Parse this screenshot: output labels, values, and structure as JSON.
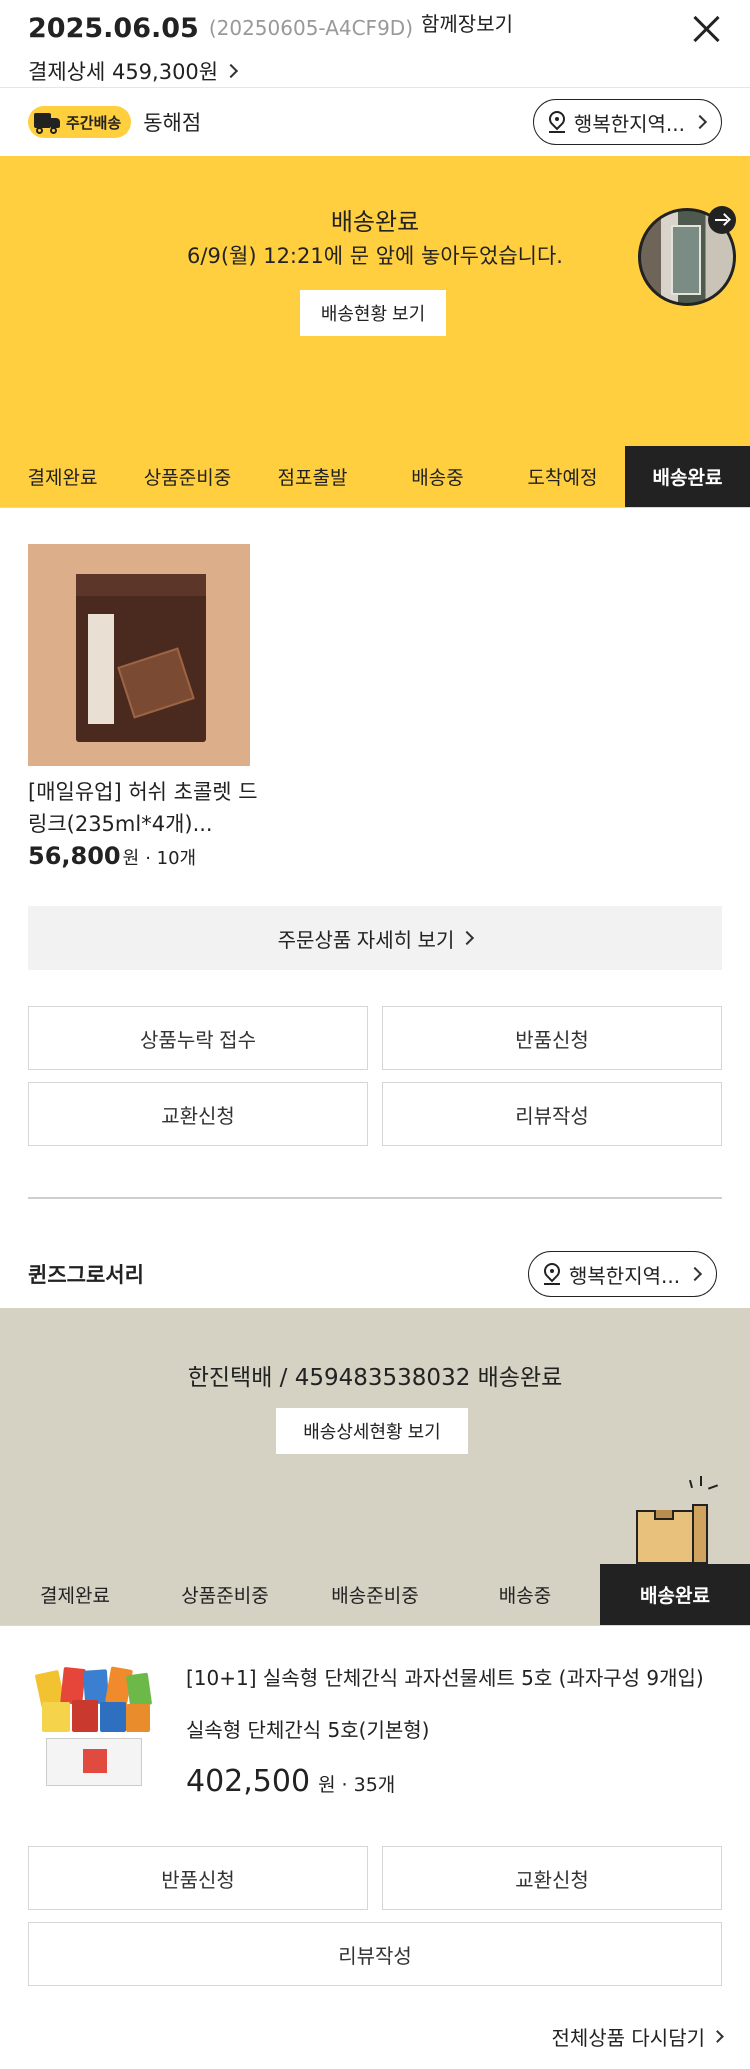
{
  "header": {
    "order_date": "2025.06.05",
    "order_no": "(20250605-A4CF9D)",
    "together_label": "함께장보기",
    "payment_detail": "결제상세 459,300원"
  },
  "shipment1": {
    "badge": "주간배송",
    "store_name": "동해점",
    "location": "행복한지역...",
    "status_title": "배송완료",
    "status_message": "6/9(월) 12:21에 문 앞에 놓아두었습니다.",
    "status_button": "배송현황 보기",
    "steps": [
      "결제완료",
      "상품준비중",
      "점포출발",
      "배송중",
      "도착예정",
      "배송완료"
    ],
    "active_step": "배송완료",
    "product": {
      "name": "[매일유업] 허쉬 초콜렛 드링크(235ml*4개)...",
      "price": "56,800",
      "unit": "원",
      "qty": "· 10개"
    },
    "detail_button": "주문상품 자세히 보기",
    "actions": [
      "상품누락 접수",
      "반품신청",
      "교환신청",
      "리뷰작성"
    ]
  },
  "shipment2": {
    "store_name": "퀸즈그로서리",
    "location": "행복한지역...",
    "status_title": "한진택배 / 459483538032 배송완료",
    "status_button": "배송상세현황 보기",
    "steps": [
      "결제완료",
      "상품준비중",
      "배송준비중",
      "배송중",
      "배송완료"
    ],
    "active_step": "배송완료",
    "product": {
      "name": "[10+1] 실속형 단체간식 과자선물세트 5호 (과자구성 9개입)",
      "option": "실속형 단체간식 5호(기본형)",
      "price": "402,500",
      "unit": "원",
      "qty": "· 35개"
    },
    "actions": [
      "반품신청",
      "교환신청",
      "리뷰작성"
    ]
  },
  "footer": {
    "rebuy_label": "전체상품 다시담기"
  },
  "colors": {
    "accent_yellow": "#ffcf40",
    "banner_beige": "#d5d1c3",
    "active_step_bg": "#222222"
  }
}
